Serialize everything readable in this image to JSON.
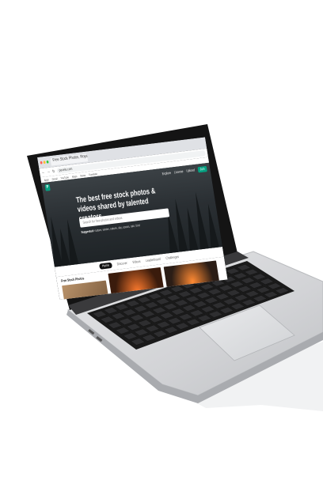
{
  "browser": {
    "tab_label": "Free Stock Photos, Royalty",
    "address": "pexels.com",
    "bookmarks": [
      "Apps",
      "Gmail",
      "YouTube",
      "Maps",
      "News",
      "Translate"
    ]
  },
  "site": {
    "logo_letter": "P",
    "nav_links": [
      "Explore",
      "License",
      "Upload"
    ],
    "join_label": "Join",
    "headline": "The best free stock photos & videos shared by talented creators.",
    "search_placeholder": "Search for free photos and videos",
    "suggested_label": "Suggested:",
    "suggested_terms": "nature, winter, nature, sky, ocean, rain, bird",
    "tabs": [
      "Home",
      "Discover",
      "Videos",
      "Leaderboard",
      "Challenges"
    ],
    "active_tab": "Home",
    "section_title": "Free Stock Photos"
  },
  "colors": {
    "brand": "#05a081",
    "laptop_body": "#d9dadc",
    "keyboard": "#1a1a1a"
  }
}
